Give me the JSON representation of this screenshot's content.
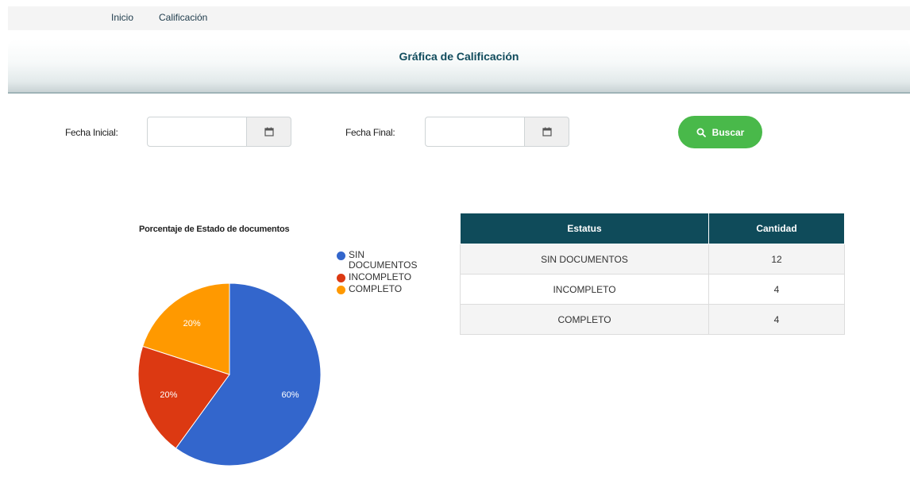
{
  "nav": {
    "items": [
      "Inicio",
      "Calificación"
    ]
  },
  "banner": {
    "title": "Gráfica de Calificación"
  },
  "filters": {
    "start_label": "Fecha Inicial:",
    "start_value": "",
    "end_label": "Fecha Final:",
    "end_value": "",
    "calendar_icon": "calendar-icon"
  },
  "search_button": {
    "label": "Buscar",
    "icon": "search-icon",
    "color": "#49b94a"
  },
  "chart_data": {
    "type": "pie",
    "title": "Porcentaje de Estado de documentos",
    "slices": [
      {
        "label": "SIN DOCUMENTOS",
        "value": 60,
        "display": "60%",
        "color": "#3366cc"
      },
      {
        "label": "INCOMPLETO",
        "value": 20,
        "display": "20%",
        "color": "#dc3912"
      },
      {
        "label": "COMPLETO",
        "value": 20,
        "display": "20%",
        "color": "#ff9900"
      }
    ],
    "legend_position": "right"
  },
  "table": {
    "headers": [
      "Estatus",
      "Cantidad"
    ],
    "rows": [
      [
        "SIN DOCUMENTOS",
        "12"
      ],
      [
        "INCOMPLETO",
        "4"
      ],
      [
        "COMPLETO",
        "4"
      ]
    ]
  },
  "colors": {
    "header_dark": "#0f4b5a",
    "title_teal": "#104b5c"
  }
}
